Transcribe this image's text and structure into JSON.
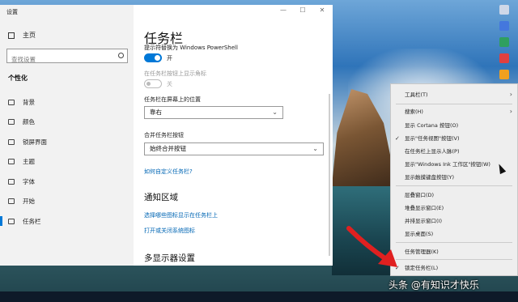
{
  "window": {
    "title": "设置",
    "controls": {
      "minimize": "—",
      "maximize": "☐",
      "close": "✕"
    }
  },
  "sidebar": {
    "home_label": "主页",
    "search_placeholder": "查找设置",
    "section_title": "个性化",
    "items": [
      {
        "label": "背景",
        "icon": "image-icon"
      },
      {
        "label": "颜色",
        "icon": "palette-icon"
      },
      {
        "label": "锁屏界面",
        "icon": "lock-screen-icon"
      },
      {
        "label": "主题",
        "icon": "brush-icon"
      },
      {
        "label": "字体",
        "icon": "font-icon"
      },
      {
        "label": "开始",
        "icon": "start-icon"
      },
      {
        "label": "任务栏",
        "icon": "taskbar-icon",
        "active": true
      }
    ]
  },
  "main": {
    "title": "任务栏",
    "powershell_label": "提示符替换为 Windows PowerShell",
    "powershell_state": "开",
    "badges_label": "在任务栏按钮上显示角标",
    "badges_state": "关",
    "position_label": "任务栏在屏幕上的位置",
    "position_value": "靠右",
    "combine_label": "合并任务栏按钮",
    "combine_value": "始终合并按钮",
    "customize_link": "如何自定义任务栏?",
    "notification_heading": "通知区域",
    "select_icons_link": "选择哪些图标显示在任务栏上",
    "system_icons_link": "打开或关闭系统图标",
    "multi_display_heading": "多显示器设置"
  },
  "context_menu": {
    "items": [
      {
        "label": "工具栏(T)",
        "submenu": true
      },
      {
        "label": "搜索(H)",
        "submenu": true
      },
      {
        "label": "显示 Cortana 按钮(O)"
      },
      {
        "label": "显示\"任务视图\"按钮(V)",
        "checked": true
      },
      {
        "label": "在任务栏上显示人脉(P)"
      },
      {
        "label": "显示\"Windows Ink 工作区\"按钮(W)"
      },
      {
        "label": "显示触摸键盘按钮(Y)"
      },
      {
        "label": "层叠窗口(D)"
      },
      {
        "label": "堆叠显示窗口(E)"
      },
      {
        "label": "并排显示窗口(I)"
      },
      {
        "label": "显示桌面(S)"
      },
      {
        "label": "任务管理器(K)"
      },
      {
        "label": "锁定任务栏(L)",
        "checked": true
      }
    ],
    "arrow_glyph": "›",
    "check_glyph": "✓"
  },
  "watermark": "头条 @有知识才快乐",
  "colors": {
    "accent": "#0078d7",
    "link": "#0066b4",
    "annotation_red": "#e02020"
  }
}
